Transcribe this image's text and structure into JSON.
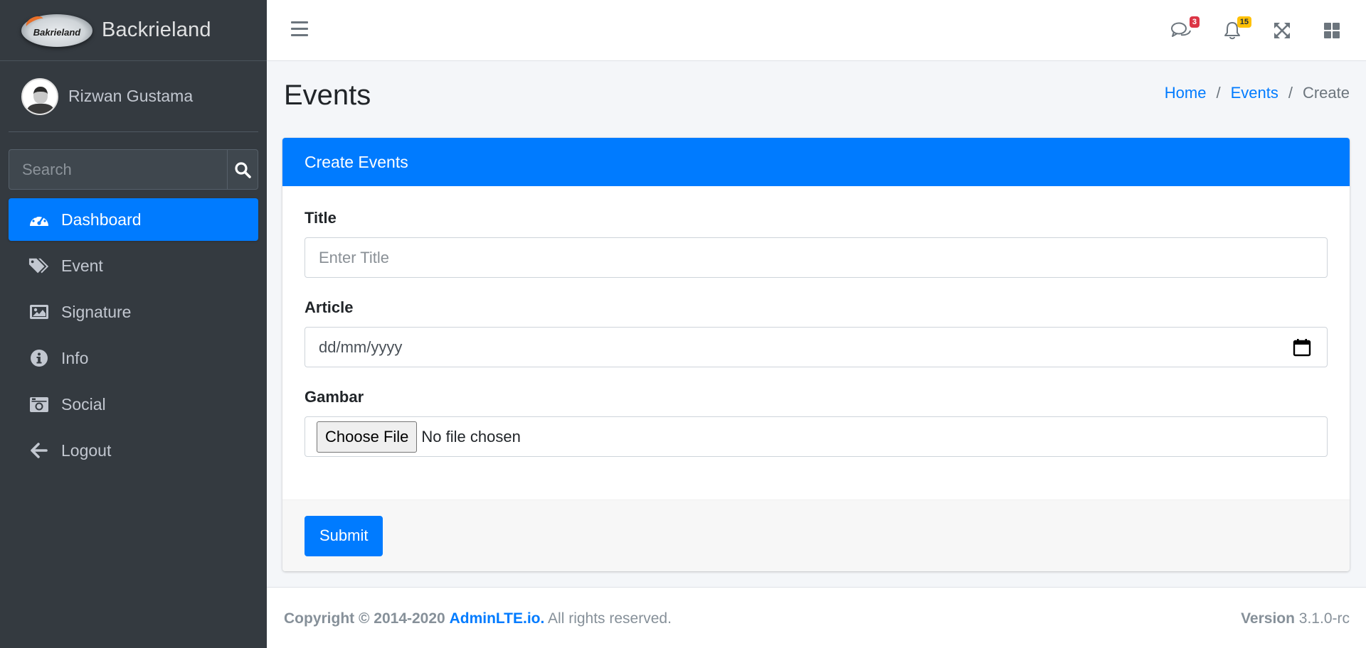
{
  "brand": {
    "logo_text": "Bakrieland",
    "name": "Backrieland"
  },
  "user": {
    "name": "Rizwan Gustama"
  },
  "search": {
    "placeholder": "Search"
  },
  "sidebar": {
    "items": [
      {
        "label": "Dashboard",
        "icon": "dashboard-icon",
        "active": true
      },
      {
        "label": "Event",
        "icon": "tags-icon",
        "active": false
      },
      {
        "label": "Signature",
        "icon": "image-icon",
        "active": false
      },
      {
        "label": "Info",
        "icon": "info-circle-icon",
        "active": false
      },
      {
        "label": "Social",
        "icon": "camera-retro-icon",
        "active": false
      },
      {
        "label": "Logout",
        "icon": "arrow-left-icon",
        "active": false
      }
    ]
  },
  "navbar": {
    "messages_count": "3",
    "notifications_count": "15"
  },
  "header": {
    "title": "Events",
    "breadcrumb": {
      "home": "Home",
      "events": "Events",
      "current": "Create"
    }
  },
  "card": {
    "title": "Create Events",
    "fields": {
      "title": {
        "label": "Title",
        "placeholder": "Enter Title"
      },
      "article": {
        "label": "Article",
        "value": "dd/mm/yyyy"
      },
      "gambar": {
        "label": "Gambar",
        "button": "Choose File",
        "status": "No file chosen"
      }
    },
    "submit_label": "Submit"
  },
  "footer": {
    "copyright": "Copyright © 2014-2020",
    "link": "AdminLTE.io.",
    "rights": "All rights reserved.",
    "version_label": "Version",
    "version": "3.1.0-rc"
  },
  "colors": {
    "primary": "#007bff",
    "sidebar": "#343a40",
    "danger": "#dc3545",
    "warning": "#ffc107"
  }
}
